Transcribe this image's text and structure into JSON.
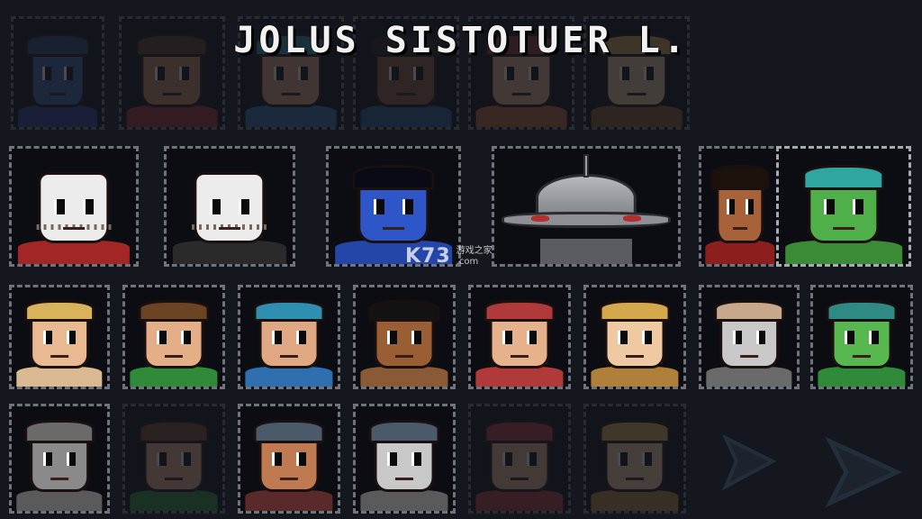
{
  "screen": {
    "title": "JOLUS SISTOTUER L."
  },
  "watermark": {
    "logo": "K73",
    "cn": "游戏之家",
    "domain": ".com"
  },
  "colors": {
    "background": "#15171e",
    "tile_border": "#6f737c",
    "title_text": "#f2f2f2"
  },
  "rows": [
    {
      "name": "row-1-faded",
      "characters": [
        {
          "name": "character-blue-hooded",
          "skin": "#3b5fa8",
          "hair": "#27406e",
          "shirt": "#2a3b8a"
        },
        {
          "name": "character-brown-hair",
          "skin": "#c58a5e",
          "hair": "#5a3a22",
          "shirt": "#9b2d2d"
        },
        {
          "name": "character-teal-helmet",
          "skin": "#d9a27a",
          "hair": "#2f8fa6",
          "shirt": "#2f6fa6"
        },
        {
          "name": "character-dark-spiky",
          "skin": "#8a5a3a",
          "hair": "#1d1d1d",
          "shirt": "#1f5a8a"
        },
        {
          "name": "character-red-cap",
          "skin": "#e0b08a",
          "hair": "#8c2e2e",
          "shirt": "#b8613a"
        },
        {
          "name": "character-blonde-long",
          "skin": "#e8c49a",
          "hair": "#c9a247",
          "shirt": "#8a5a2a"
        }
      ]
    },
    {
      "name": "row-2",
      "characters": [
        {
          "name": "character-hockey-mask-red",
          "skin": "#ececec",
          "hair": "#ececec",
          "shirt": "#a32626",
          "mask": true
        },
        {
          "name": "character-hockey-mask-dark",
          "skin": "#ececec",
          "hair": "#ececec",
          "shirt": "#2a2a2a",
          "mask": true
        },
        {
          "name": "character-blue-skin",
          "skin": "#2f56c8",
          "hair": "#0a0a14",
          "shirt": "#2446a8"
        },
        {
          "name": "character-robot-dome",
          "skin": "#9a9ca2",
          "hair": "#6d7076",
          "shirt": "#5a5c62",
          "robot": true
        },
        {
          "name": "character-dark-skin-red-shirt",
          "skin": "#a8623a",
          "hair": "#1c120c",
          "shirt": "#8c1e1e"
        },
        {
          "name": "character-green-skin-teal-hair",
          "skin": "#4fb04a",
          "hair": "#2fa6a0",
          "shirt": "#3a8a36"
        }
      ]
    },
    {
      "name": "row-3",
      "characters": [
        {
          "name": "character-blonde-headband",
          "skin": "#e9b992",
          "hair": "#d9b35c",
          "shirt": "#d9b992"
        },
        {
          "name": "character-brown-hair-green",
          "skin": "#e4ae86",
          "hair": "#6b4424",
          "shirt": "#2f8a3a"
        },
        {
          "name": "character-teal-helmet-blue",
          "skin": "#e0a882",
          "hair": "#2f8fb0",
          "shirt": "#2f6fb0"
        },
        {
          "name": "character-goggles-black-hair",
          "skin": "#9a5e34",
          "hair": "#121212",
          "shirt": "#8a5a36"
        },
        {
          "name": "character-red-cap-bandana",
          "skin": "#e6b28c",
          "hair": "#b03a3a",
          "shirt": "#b03a3a"
        },
        {
          "name": "character-blonde-girl",
          "skin": "#efc9a2",
          "hair": "#d6a84e",
          "shirt": "#b0803a"
        },
        {
          "name": "character-bald-grey",
          "skin": "#c8c8c8",
          "hair": "#c8a88a",
          "shirt": "#6a6a6a"
        },
        {
          "name": "character-green-helmet-ponytail",
          "skin": "#56b84e",
          "hair": "#2f8a86",
          "shirt": "#2f8a3a"
        }
      ]
    },
    {
      "name": "row-4",
      "characters": [
        {
          "name": "character-grey-knight",
          "skin": "#8a8a8a",
          "hair": "#6a6a6a",
          "shirt": "#5a5a5a"
        },
        {
          "name": "character-brown-hair-faded",
          "skin": "#e4ae86",
          "hair": "#6b4424",
          "shirt": "#2f8a3a",
          "dim": true
        },
        {
          "name": "character-striped-helmet-red",
          "skin": "#c07a52",
          "hair": "#4a5a6a",
          "shirt": "#5a2a2a"
        },
        {
          "name": "character-striped-helmet-grey",
          "skin": "#c8c8c8",
          "hair": "#4a5a6a",
          "shirt": "#5a5a5a"
        },
        {
          "name": "character-red-cap-faded",
          "skin": "#e6b28c",
          "hair": "#b03a3a",
          "shirt": "#b03a3a",
          "dim": true
        },
        {
          "name": "character-blonde-girl-faded",
          "skin": "#efc9a2",
          "hair": "#d6a84e",
          "shirt": "#b0803a",
          "dim": true
        }
      ]
    }
  ],
  "controls": {
    "prev_icon": "arrow-left-icon",
    "next_icon": "arrow-right-icon"
  }
}
